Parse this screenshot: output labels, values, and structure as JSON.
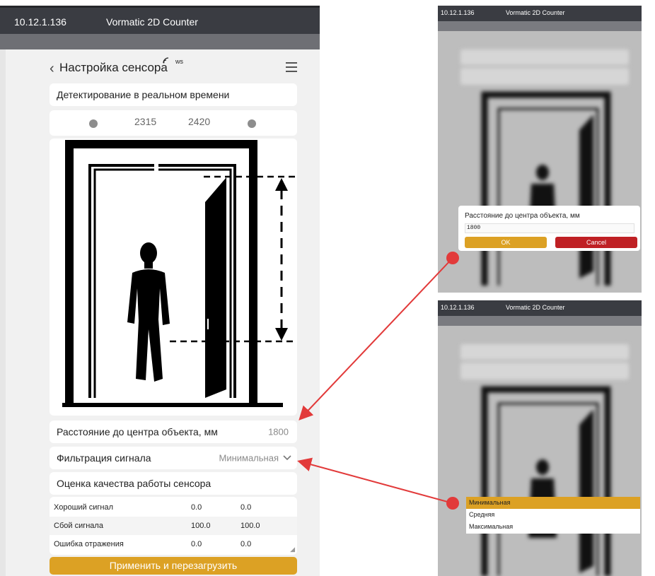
{
  "window": {
    "ip": "10.12.1.136",
    "app_title": "Vormatic 2D Counter"
  },
  "header": {
    "back_glyph": "‹",
    "title": "Настройка сенсора",
    "ws_badge": "ws"
  },
  "realtime": {
    "label": "Детектирование в реальном времени",
    "value_left": "2315",
    "value_right": "2420"
  },
  "distance": {
    "label": "Расстояние до центра объекта, мм",
    "value": "1800"
  },
  "filter": {
    "label": "Фильтрация сигнала",
    "value": "Минимальная"
  },
  "quality": {
    "title": "Оценка качества работы сенсора",
    "rows": [
      {
        "name": "Хороший сигнал",
        "v1": "0.0",
        "v2": "0.0"
      },
      {
        "name": "Сбой сигнала",
        "v1": "100.0",
        "v2": "100.0"
      },
      {
        "name": "Ошибка отражения",
        "v1": "0.0",
        "v2": "0.0"
      }
    ]
  },
  "apply_button": "Применить и перезагрузить",
  "dialog": {
    "title": "Расстояние до центра объекта, мм",
    "input_value": "1800",
    "ok": "OK",
    "cancel": "Cancel"
  },
  "dropdown": {
    "options": [
      "Минимальная",
      "Средняя",
      "Максимальная"
    ],
    "selected": "Минимальная"
  },
  "colors": {
    "accent": "#dca124",
    "cancel": "#bf2024",
    "arrow": "#e23a3a",
    "titlebar": "#3a3c42"
  },
  "icons": [
    "menu-icon",
    "chevron-down-icon",
    "signal-dot-icon",
    "door-illustration"
  ]
}
